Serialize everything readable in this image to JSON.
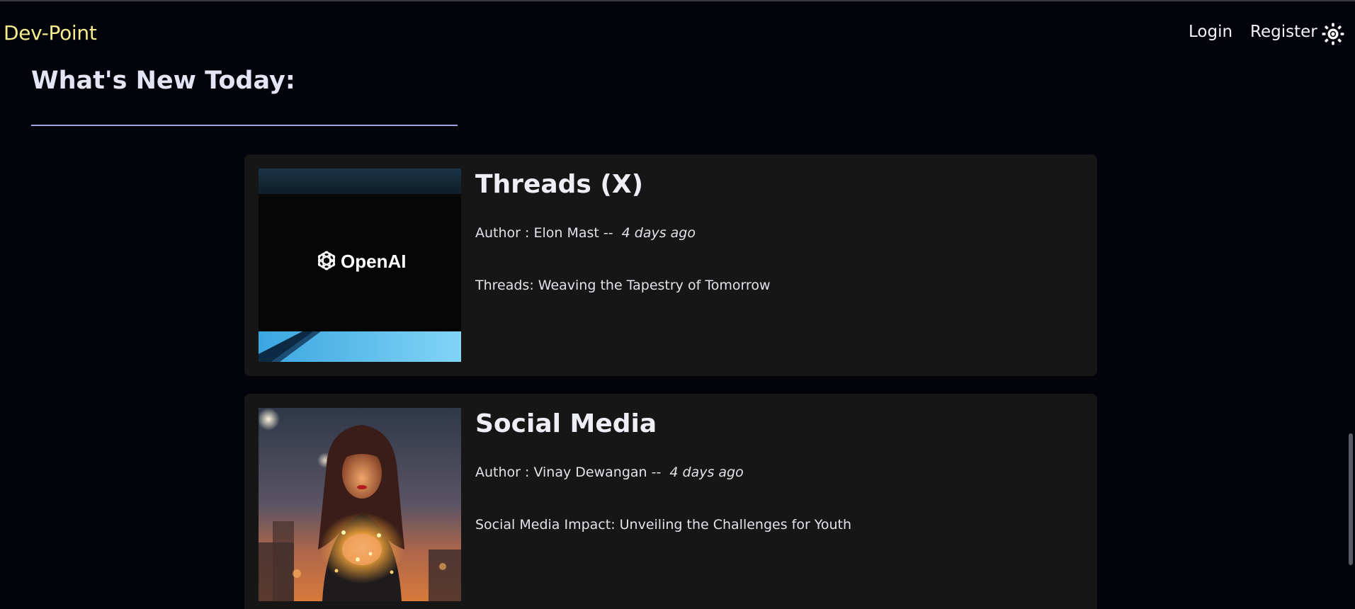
{
  "navbar": {
    "brand": "Dev-Point",
    "login": "Login",
    "register": "Register",
    "theme_icon": "sun-icon"
  },
  "section": {
    "title": "What's New Today:"
  },
  "posts": [
    {
      "title": "Threads (X)",
      "author_label": "Author : Elon Mast --",
      "date": "4 days ago",
      "description": "Threads: Weaving the Tapestry of Tomorrow",
      "thumbnail_text": "OpenAI",
      "thumbnail_icon": "openai-logo-icon"
    },
    {
      "title": "Social Media",
      "author_label": "Author : Vinay Dewangan --",
      "date": "4 days ago",
      "description": "Social Media Impact: Unveiling the Challenges for Youth",
      "thumbnail_icon": "portrait-photo"
    }
  ],
  "colors": {
    "background": "#03030b",
    "brand": "#f5ec8c",
    "card": "#161617",
    "rule": "#9ea2e6"
  }
}
